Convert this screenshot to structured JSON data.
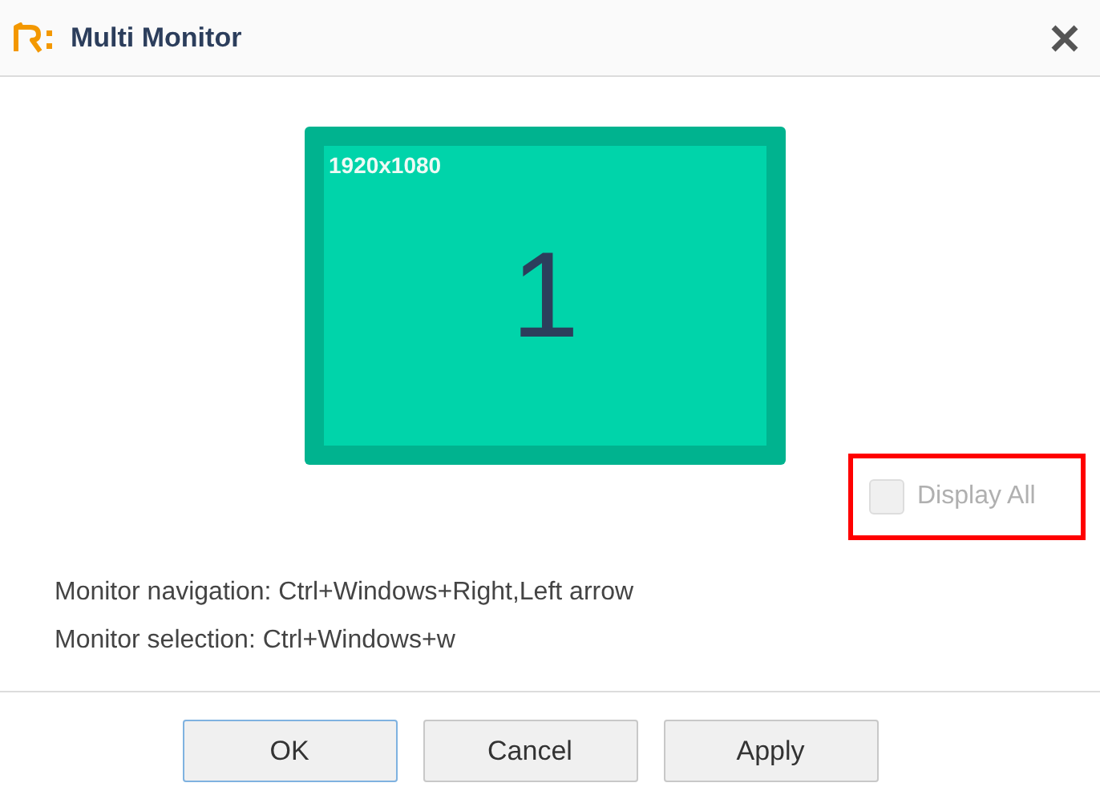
{
  "window": {
    "title": "Multi Monitor"
  },
  "monitors": [
    {
      "resolution": "1920x1080",
      "number": "1",
      "selected": true
    }
  ],
  "display_all": {
    "label": "Display All",
    "checked": false,
    "disabled": true,
    "highlighted": true
  },
  "hints": [
    "Monitor navigation: Ctrl+Windows+Right,Left arrow",
    "Monitor selection: Ctrl+Windows+w"
  ],
  "buttons": [
    {
      "label": "OK",
      "focused": true
    },
    {
      "label": "Cancel",
      "focused": false
    },
    {
      "label": "Apply",
      "focused": false
    }
  ]
}
